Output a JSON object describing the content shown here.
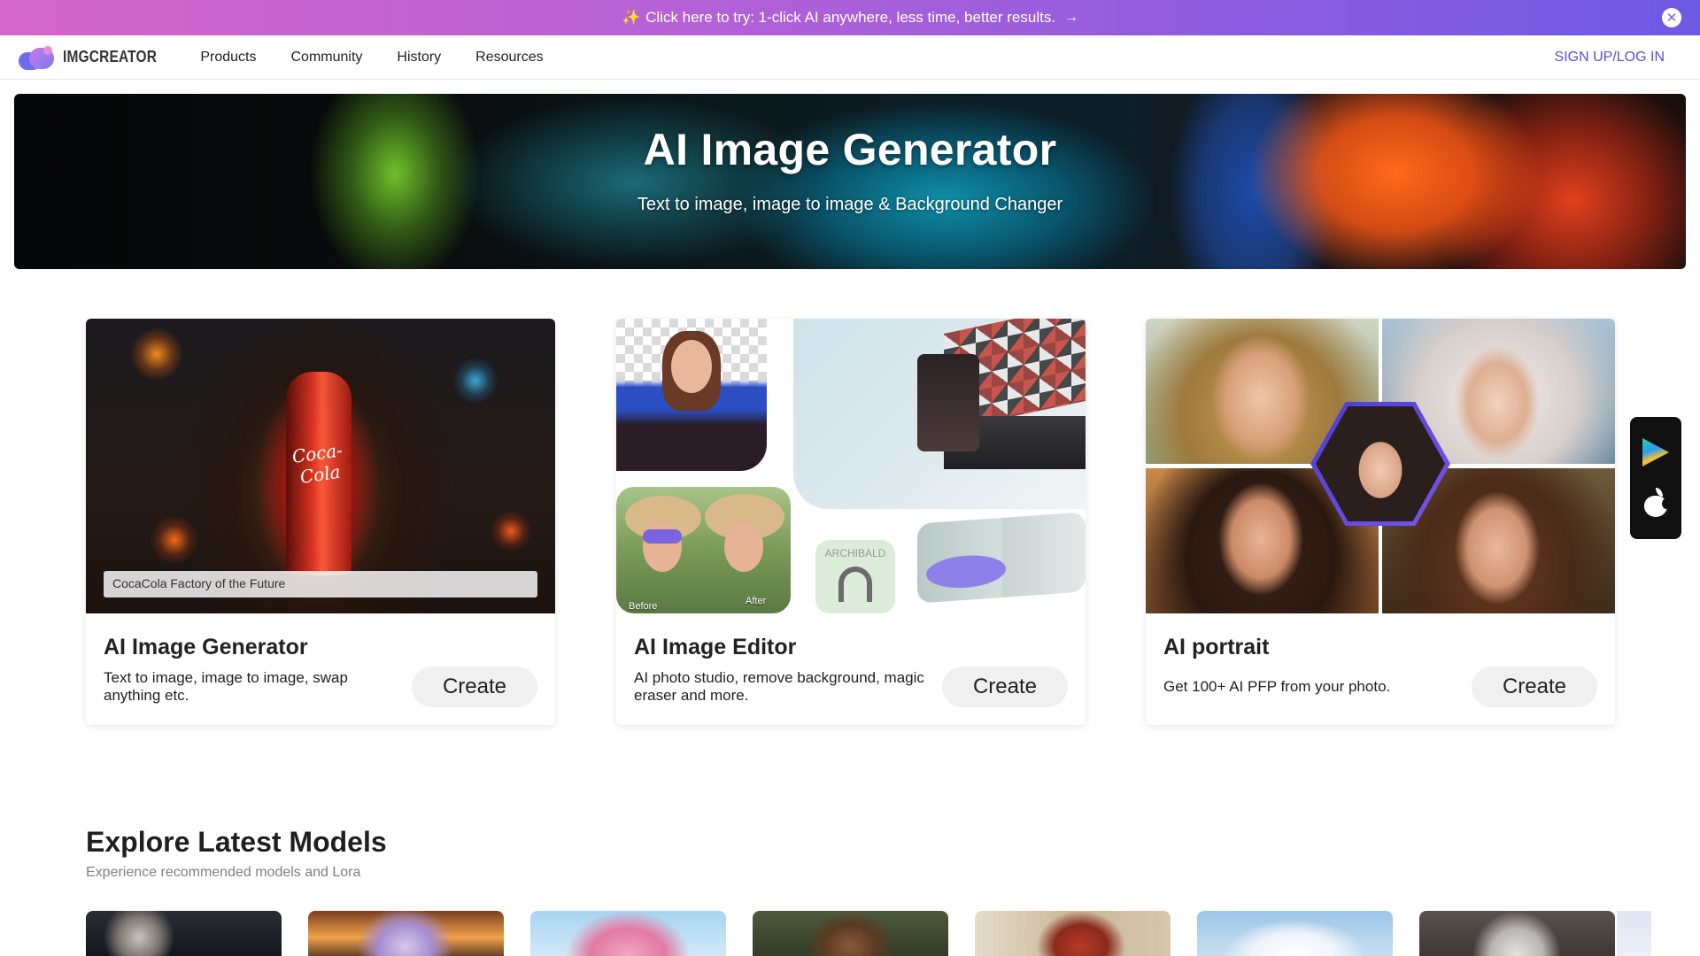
{
  "promo": {
    "icon": "sparkles-icon",
    "text": "Click here to try: 1-click AI anywhere, less time, better results.",
    "arrow": "→",
    "close": "✕"
  },
  "nav": {
    "logo_text": "IMGCREATOR",
    "items": [
      "Products",
      "Community",
      "History",
      "Resources"
    ],
    "signup": "SIGN UP/LOG IN"
  },
  "hero": {
    "title": "AI Image Generator",
    "subtitle": "Text to image, image to image & Background Changer"
  },
  "cards": [
    {
      "title": "AI Image Generator",
      "description": "Text to image, image to image, swap anything etc.",
      "button": "Create",
      "caption": "CocaCola Factory of the Future",
      "image_text": "Coca-Cola"
    },
    {
      "title": "AI Image Editor",
      "description": "AI photo studio, remove background, magic eraser and more.",
      "button": "Create",
      "labels": {
        "before": "Before",
        "after": "After",
        "brand": "ARCHIBALD"
      }
    },
    {
      "title": "AI portrait",
      "description": "Get 100+ AI PFP from your photo.",
      "button": "Create"
    }
  ],
  "store_widget": {
    "icons": [
      "google-play-icon",
      "apple-icon"
    ]
  },
  "explore": {
    "title": "Explore Latest Models",
    "subtitle": "Experience recommended models and Lora"
  },
  "colors": {
    "accent": "#5b4ee0",
    "promo_start": "#d467c9",
    "promo_end": "#6e5ae3"
  }
}
